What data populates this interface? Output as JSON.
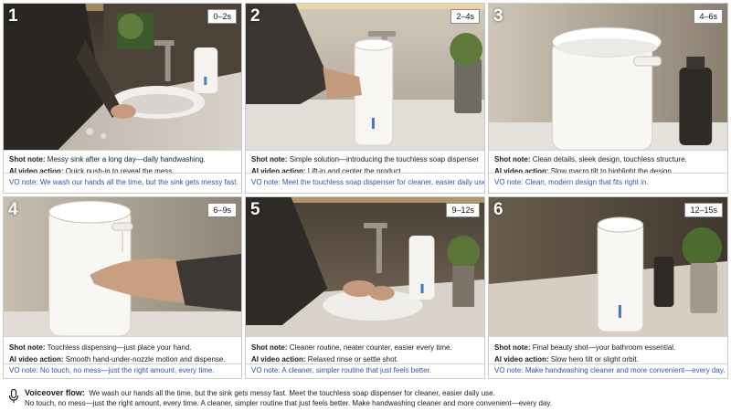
{
  "shots": [
    {
      "number": "1",
      "time": "0–2s",
      "shot_note": "Messy sink after a long day—daily handwashing.",
      "ai_action": "Quick push-in to reveal the mess.",
      "vo": "We wash our hands all the time, but the sink gets messy fast."
    },
    {
      "number": "2",
      "time": "2–4s",
      "shot_note": "Simple solution—introducing the touchless soap dispenser.",
      "ai_action": "Lift-in and center the product.",
      "vo": "Meet the touchless soap dispenser for cleaner, easier daily use."
    },
    {
      "number": "3",
      "time": "4–6s",
      "shot_note": "Clean details, sleek design, touchless structure.",
      "ai_action": "Slow macro tilt to highlight the design.",
      "vo": "Clean, modern design that fits right in."
    },
    {
      "number": "4",
      "time": "6–9s",
      "shot_note": "Touchless dispensing—just place your hand.",
      "ai_action": "Smooth hand-under-nozzle motion and dispense.",
      "vo": "No touch, no mess—just the right amount, every time."
    },
    {
      "number": "5",
      "time": "9–12s",
      "shot_note": "Cleaner routine, neater counter, easier every time.",
      "ai_action": "Relaxed rinse or settle shot.",
      "vo": "A cleaner, simpler routine that just feels better."
    },
    {
      "number": "6",
      "time": "12–15s",
      "shot_note": "Final beauty shot—your bathroom essential.",
      "ai_action": "Slow hero tilt or slight orbit.",
      "vo": "Make handwashing cleaner and more convenient—every day."
    }
  ],
  "labels": {
    "shot_note": "Shot note:",
    "ai_action": "AI video action:",
    "vo": "VO note:"
  },
  "voiceover": {
    "title": "Voiceover flow:",
    "line1": "We wash our hands all the time, but the sink gets messy fast. Meet the touchless soap dispenser for cleaner, easier daily use.",
    "line2": "No touch, no mess—just the right amount, every time. A cleaner, simpler routine that just feels better. Make handwashing cleaner and more convenient—every day."
  },
  "colors": {
    "vo_text": "#2f56a6",
    "border": "#c9c9c9"
  },
  "icons": {
    "voiceover": "microphone-icon"
  }
}
